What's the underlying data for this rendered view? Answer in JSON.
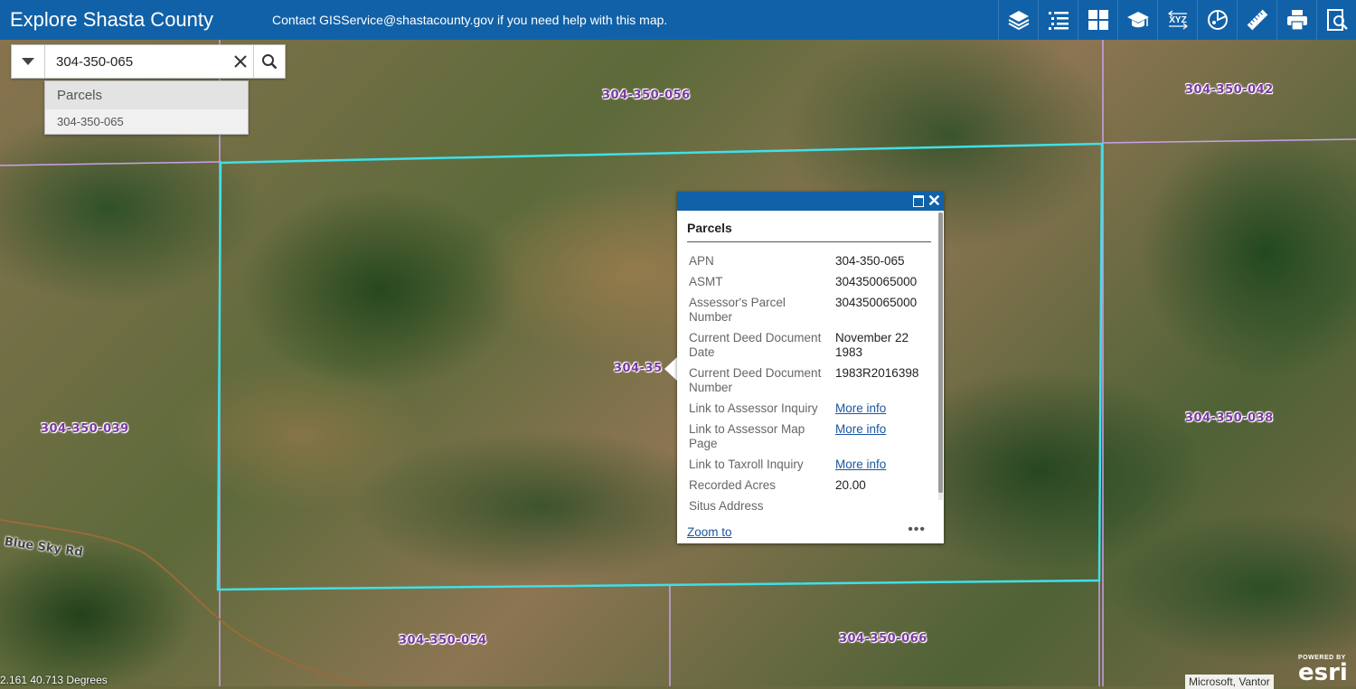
{
  "header": {
    "title": "Explore Shasta County",
    "subtitle": "Contact GISService@shastacounty.gov if you need help with this map.",
    "tools": [
      "layers-icon",
      "legend-list-icon",
      "basemap-gallery-icon",
      "training-icon",
      "xyz-coordinates-icon",
      "chart-icon",
      "measure-icon",
      "print-icon",
      "query-icon"
    ],
    "xyz_label": "XYZ",
    "bg_color": "#1161a8"
  },
  "search": {
    "value": "304-350-065",
    "suggest_header": "Parcels",
    "suggestion": "304-350-065"
  },
  "map": {
    "parcel_labels": [
      "304-350-056",
      "304-350-042",
      "304-350-039",
      "304-350-038",
      "304-350-054",
      "304-350-066",
      "304-35"
    ],
    "road_label": "Blue Sky Rd",
    "coords": "2.161 40.713 Degrees",
    "attribution": "Microsoft, Vantor",
    "esri_powered": "POWERED BY",
    "esri_wordmark": "esri",
    "selection_color": "#3fe0e8"
  },
  "popup": {
    "layer_title": "Parcels",
    "attributes": [
      {
        "key": "APN",
        "value": "304-350-065"
      },
      {
        "key": "ASMT",
        "value": "304350065000"
      },
      {
        "key": "Assessor's Parcel Number",
        "value": "304350065000"
      },
      {
        "key": "Current Deed Document Date",
        "value": "November 22 1983"
      },
      {
        "key": "Current Deed Document Number",
        "value": "1983R2016398"
      },
      {
        "key": "Link to Assessor Inquiry",
        "value": "More info",
        "link": true
      },
      {
        "key": "Link to Assessor Map Page",
        "value": "More info",
        "link": true
      },
      {
        "key": "Link to Taxroll Inquiry",
        "value": "More info",
        "link": true
      },
      {
        "key": "Recorded Acres",
        "value": "20.00"
      },
      {
        "key": "Situs Address",
        "value": ""
      }
    ],
    "zoom_to": "Zoom to",
    "more": "•••"
  }
}
